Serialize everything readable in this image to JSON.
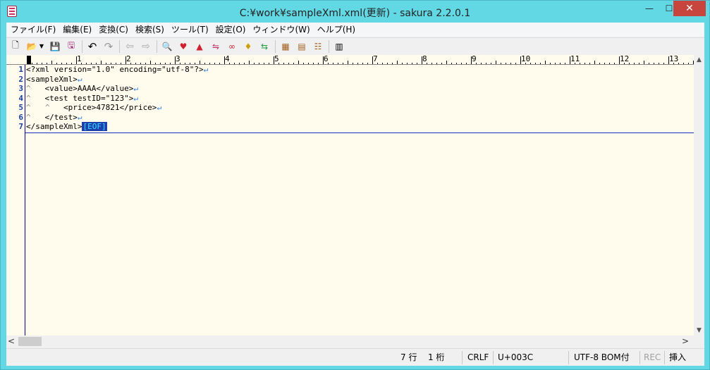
{
  "window": {
    "title": "C:¥work¥sampleXml.xml(更新) - sakura 2.2.0.1",
    "min_glyph": "—",
    "max_glyph": "☐",
    "close_glyph": "✕"
  },
  "menu": [
    "ファイル(F)",
    "編集(E)",
    "変換(C)",
    "検索(S)",
    "ツール(T)",
    "設定(O)",
    "ウィンドウ(W)",
    "ヘルプ(H)"
  ],
  "toolbar": {
    "icons": [
      "new-file-icon",
      "open-folder-icon",
      "save-icon",
      "save-all-icon",
      "undo-icon",
      "redo-icon",
      "back-icon",
      "forward-icon",
      "search-icon",
      "search-next-icon",
      "search-prev-icon",
      "replace-icon",
      "bookmark-icon",
      "mark-icon",
      "tag-jump-icon",
      "grep-icon",
      "compare-icon",
      "outline-icon"
    ],
    "glyphs": {
      "new": "🗋",
      "open": "📂",
      "dropdown": "▼",
      "save": "💾",
      "save_all": "🖫",
      "undo": "↶",
      "redo": "↷",
      "back": "⇦",
      "forward": "⇨",
      "search": "🔍",
      "search_next": "♥",
      "search_prev": "▲",
      "replace": "⇋",
      "bookmark": "∞",
      "mark": "♦",
      "tag_jump": "⇆",
      "grep": "▦",
      "compare": "▤",
      "outline": "☷",
      "list": "▥"
    }
  },
  "ruler": {
    "numbers": [
      "1",
      "2",
      "3",
      "4",
      "5",
      "6",
      "7",
      "8",
      "9",
      "10",
      "11",
      "12",
      "13"
    ]
  },
  "editor": {
    "line_numbers": [
      "1",
      "2",
      "3",
      "4",
      "5",
      "6",
      "7"
    ],
    "lines": [
      "<?xml version=\"1.0\" encoding=\"utf-8\"?>",
      "<sampleXml>",
      "    <value>AAAA</value>",
      "    <test testID=\"123\">",
      "        <price>47821</price>",
      "    </test>",
      "</sampleXml>"
    ],
    "tab_mark": "^",
    "newline_mark": "↵",
    "eof_marker": "[EOF]"
  },
  "scrollbar": {
    "left": "<",
    "right": ">",
    "up": "▲",
    "down": "▼"
  },
  "status": {
    "line": "7 行",
    "col": "1 桁",
    "eol": "CRLF",
    "code": "U+003C",
    "encoding": "UTF-8 BOM付",
    "rec": "REC",
    "mode": "挿入"
  }
}
